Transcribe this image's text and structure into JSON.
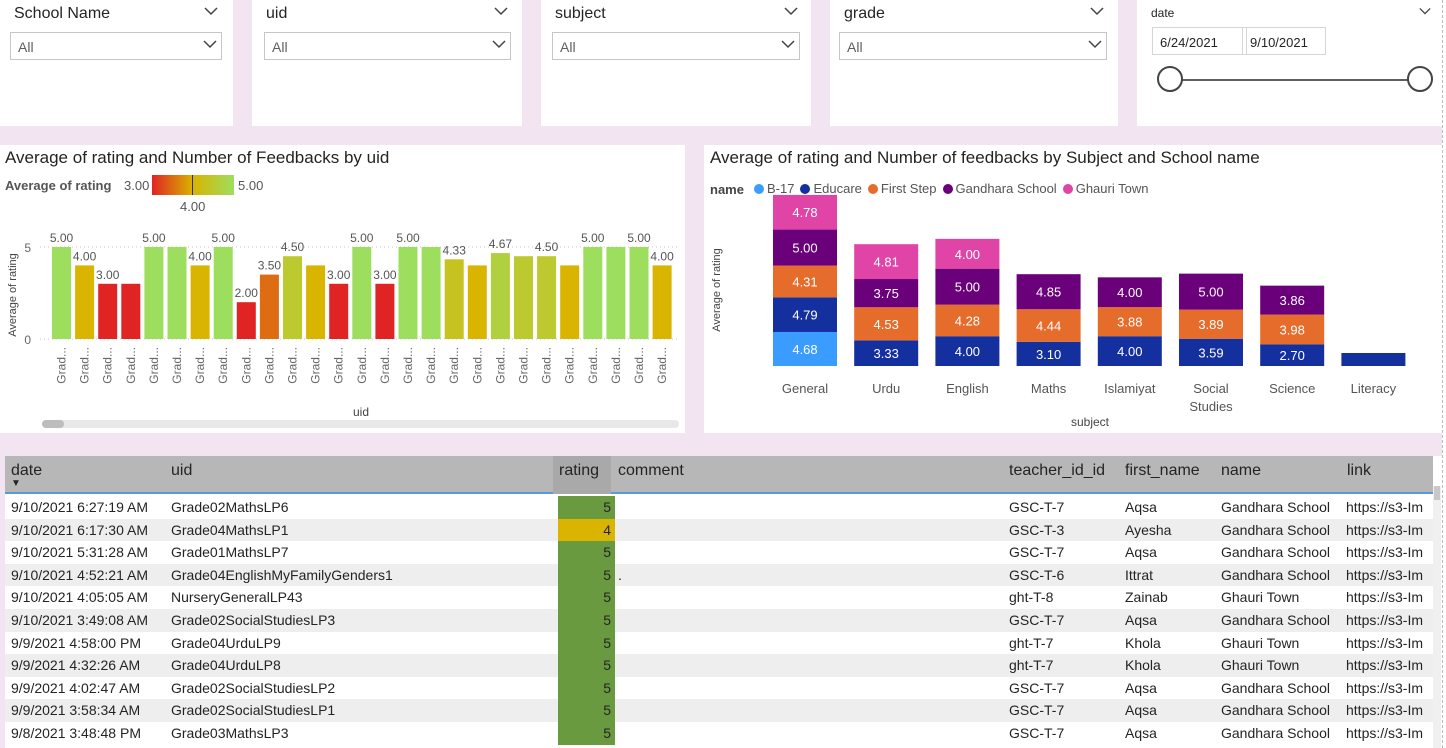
{
  "slicers": [
    {
      "label": "School Name",
      "value": "All"
    },
    {
      "label": "uid",
      "value": "All"
    },
    {
      "label": "subject",
      "value": "All"
    },
    {
      "label": "grade",
      "value": "All"
    }
  ],
  "date_slicer": {
    "label": "date",
    "start": "6/24/2021",
    "end": "9/10/2021"
  },
  "chart1": {
    "title": "Average of rating and Number of Feedbacks by uid",
    "legend_label": "Average of rating",
    "legend_min": "3.00",
    "legend_max": "5.00",
    "legend_mid": "4.00",
    "ylabel": "Average of rating",
    "xlabel": "uid",
    "ytick_0": "0",
    "ytick_5": "5",
    "tick_label": "Grad..."
  },
  "chart2": {
    "title": "Average of rating and Number of feedbacks by Subject and School name",
    "legend_title": "name",
    "ylabel": "Average of rating",
    "xlabel": "subject"
  },
  "chart_data": [
    {
      "type": "bar",
      "title": "Average of rating and Number of Feedbacks by uid",
      "xlabel": "uid",
      "ylabel": "Average of rating",
      "ylim": [
        0,
        5.5
      ],
      "values": [
        5.0,
        4.0,
        3.0,
        3.0,
        5.0,
        5.0,
        4.0,
        5.0,
        2.0,
        3.5,
        4.5,
        4.0,
        3.0,
        5.0,
        3.0,
        5.0,
        5.0,
        4.33,
        4.0,
        4.67,
        4.5,
        4.5,
        4.0,
        5.0,
        5.0,
        5.0,
        4.0
      ],
      "data_labels": [
        "5.00",
        "4.00",
        "3.00",
        "",
        "5.00",
        "",
        "4.00",
        "5.00",
        "2.00",
        "3.50",
        "4.50",
        "",
        "3.00",
        "5.00",
        "3.00",
        "5.00",
        "",
        "4.33",
        "",
        "4.67",
        "",
        "4.50",
        "",
        "5.00",
        "",
        "5.00",
        "4.00"
      ],
      "color_scale": {
        "min": 3.0,
        "mid": 4.0,
        "max": 5.0,
        "colors": [
          "#e02424",
          "#d9b400",
          "#9ede5e"
        ]
      }
    },
    {
      "type": "bar",
      "stacked": true,
      "title": "Average of rating and Number of feedbacks by Subject and School name",
      "xlabel": "subject",
      "ylabel": "Average of rating",
      "categories": [
        "General",
        "Urdu",
        "English",
        "Maths",
        "Islamiyat",
        "Social Studies",
        "Science",
        "Literacy"
      ],
      "series": [
        {
          "name": "B-17",
          "color": "#3b9cff",
          "values": [
            4.68,
            null,
            null,
            null,
            null,
            null,
            null,
            null
          ]
        },
        {
          "name": "Educare",
          "color": "#142f9e",
          "values": [
            4.79,
            3.33,
            4.0,
            3.1,
            4.0,
            3.59,
            2.7,
            null
          ]
        },
        {
          "name": "First Step",
          "color": "#e66c2c",
          "values": [
            4.31,
            4.53,
            4.28,
            4.44,
            3.88,
            3.89,
            3.98,
            null
          ]
        },
        {
          "name": "Gandhara School",
          "color": "#6b007b",
          "values": [
            5.0,
            3.75,
            5.0,
            4.85,
            4.0,
            5.0,
            3.86,
            null
          ]
        },
        {
          "name": "Ghauri Town",
          "color": "#e044a7",
          "values": [
            4.78,
            4.81,
            4.0,
            null,
            null,
            null,
            null,
            null
          ]
        }
      ],
      "extra_segments": [
        {
          "category": "Literacy",
          "series": "Educare",
          "label": ""
        }
      ]
    }
  ],
  "table": {
    "columns": [
      "date",
      "uid",
      "rating",
      "comment",
      "teacher_id_id",
      "first_name",
      "name",
      "link"
    ],
    "rows": [
      [
        "9/10/2021 6:27:19 AM",
        "Grade02MathsLP6",
        "5",
        "",
        "GSC-T-7",
        "Aqsa",
        "Gandhara School",
        "https://s3-Im"
      ],
      [
        "9/10/2021 6:17:30 AM",
        "Grade04MathsLP1",
        "4",
        "",
        "GSC-T-3",
        "Ayesha",
        "Gandhara School",
        "https://s3-Im"
      ],
      [
        "9/10/2021 5:31:28 AM",
        "Grade01MathsLP7",
        "5",
        "",
        "GSC-T-7",
        "Aqsa",
        "Gandhara School",
        "https://s3-Im"
      ],
      [
        "9/10/2021 4:52:21 AM",
        "Grade04EnglishMyFamilyGenders1",
        "5",
        ".",
        "GSC-T-6",
        "Ittrat",
        "Gandhara School",
        "https://s3-Im"
      ],
      [
        "9/10/2021 4:05:05 AM",
        "NurseryGeneralLP43",
        "5",
        "",
        "ght-T-8",
        "Zainab",
        "Ghauri Town",
        "https://s3-Im"
      ],
      [
        "9/10/2021 3:49:08 AM",
        "Grade02SocialStudiesLP3",
        "5",
        "",
        "GSC-T-7",
        "Aqsa",
        "Gandhara School",
        "https://s3-Im"
      ],
      [
        "9/9/2021 4:58:00 PM",
        "Grade04UrduLP9",
        "5",
        "",
        "ght-T-7",
        "Khola",
        "Ghauri Town",
        "https://s3-Im"
      ],
      [
        "9/9/2021 4:32:26 AM",
        "Grade04UrduLP8",
        "5",
        "",
        "ght-T-7",
        "Khola",
        "Ghauri Town",
        "https://s3-Im"
      ],
      [
        "9/9/2021 4:02:47 AM",
        "Grade02SocialStudiesLP2",
        "5",
        "",
        "GSC-T-7",
        "Aqsa",
        "Gandhara School",
        "https://s3-Im"
      ],
      [
        "9/9/2021 3:58:34 AM",
        "Grade02SocialStudiesLP1",
        "5",
        "",
        "GSC-T-7",
        "Aqsa",
        "Gandhara School",
        "https://s3-Im"
      ],
      [
        "9/8/2021 3:48:48 PM",
        "Grade03MathsLP3",
        "5",
        "",
        "GSC-T-7",
        "Aqsa",
        "Gandhara School",
        "https://s3-Im"
      ]
    ],
    "rating_colors": {
      "5": "#6a9a3f",
      "4": "#d9b400"
    }
  }
}
